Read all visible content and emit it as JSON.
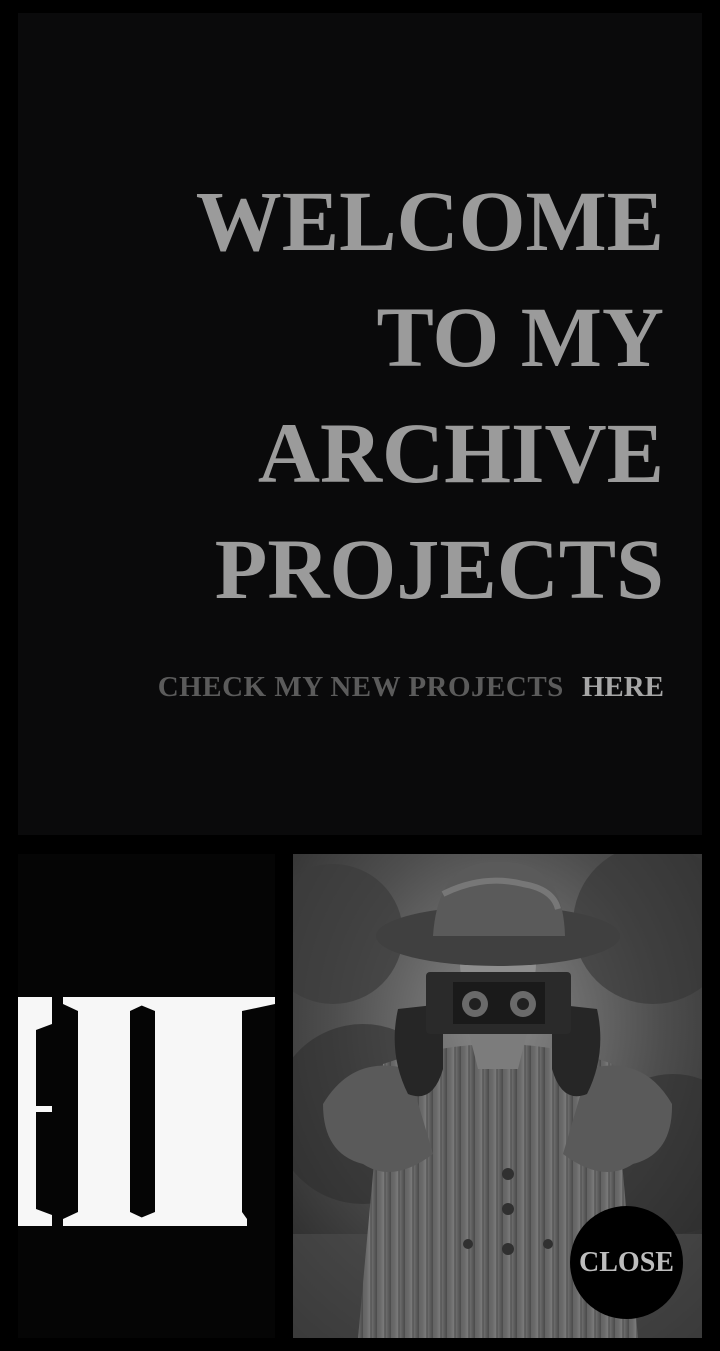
{
  "hero": {
    "title_lines": [
      "WELCOME",
      "TO MY",
      "ARCHIVE",
      "PROJECTS"
    ],
    "cta_text": "CHECK MY NEW PROJECTS",
    "cta_link": "HERE"
  },
  "decor": {
    "letters": "II"
  },
  "photo": {
    "subject": "vintage-woman-with-stereo-camera"
  },
  "close_button": {
    "label": "CLOSE"
  },
  "colors": {
    "background": "#000000",
    "panel": "#0a0a0b",
    "title": "#9b9b9b",
    "cta_text": "#5b5b5b",
    "cta_link": "#a6a6a6",
    "letters": "#f7f7f7",
    "close_text": "#bdbdbd"
  }
}
